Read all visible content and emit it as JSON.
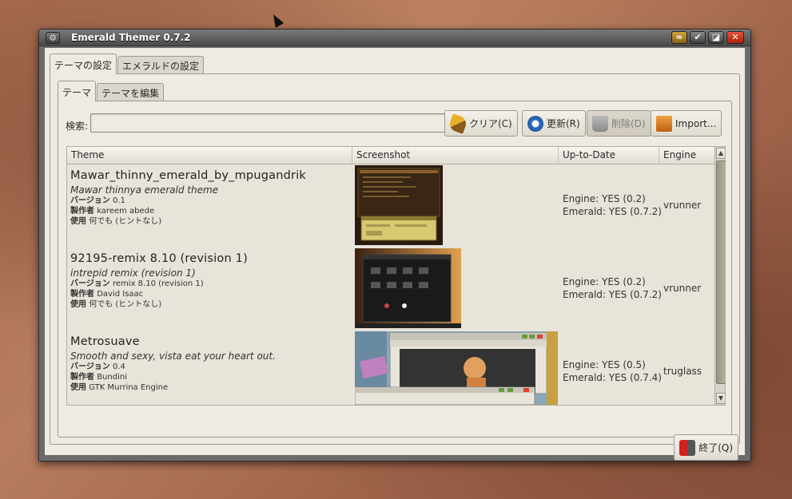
{
  "window": {
    "title": "Emerald Themer 0.7.2",
    "menu_glyph": "⚙",
    "titlebar_buttons": [
      {
        "name": "roll-up-button",
        "glyph": "≈"
      },
      {
        "name": "maximize-button",
        "glyph": "✔"
      },
      {
        "name": "minimize-button",
        "glyph": "◪"
      },
      {
        "name": "close-button",
        "glyph": "✕"
      }
    ]
  },
  "outer_tabs": [
    {
      "label": "テーマの設定",
      "active": true
    },
    {
      "label": "エメラルドの設定",
      "active": false
    }
  ],
  "inner_tabs": [
    {
      "label": "テーマ",
      "active": true
    },
    {
      "label": "テーマを編集",
      "active": false
    }
  ],
  "search": {
    "label": "検索:",
    "value": "",
    "placeholder": ""
  },
  "toolbar": {
    "clear_label": "クリア(C)",
    "update_label": "更新(R)",
    "delete_label": "削除(D)",
    "import_label": "Import..."
  },
  "table": {
    "columns": [
      "Theme",
      "Screenshot",
      "Up-to-Date",
      "Engine"
    ],
    "rows": [
      {
        "name": "Mawar_thinny_emerald_by_mpugandrik",
        "description": "Mawar thinnya emerald theme",
        "version_label": "バージョン",
        "version": "0.1",
        "author_label": "製作者",
        "author": "kareem abede",
        "usage_label": "使用",
        "usage": "何でも (ヒントなし)",
        "engine_status": "Engine: YES (0.2)",
        "emerald_status": "Emerald: YES (0.7.2)",
        "engine": "vrunner"
      },
      {
        "name": "92195-remix 8.10 (revision 1)",
        "description": "intrepid remix (revision 1)",
        "version_label": "バージョン",
        "version": "remix 8.10 (revision 1)",
        "author_label": "製作者",
        "author": "David Isaac",
        "usage_label": "使用",
        "usage": "何でも (ヒントなし)",
        "engine_status": "Engine: YES (0.2)",
        "emerald_status": "Emerald: YES (0.7.2)",
        "engine": "vrunner"
      },
      {
        "name": "Metrosuave",
        "description": "Smooth and sexy, vista eat your heart out.",
        "version_label": "バージョン",
        "version": "0.4",
        "author_label": "製作者",
        "author": "Bundini",
        "usage_label": "使用",
        "usage": "GTK Murrina Engine",
        "engine_status": "Engine: YES (0.5)",
        "emerald_status": "Emerald: YES (0.7.4)",
        "engine": "truglass"
      }
    ]
  },
  "scrollbar": {
    "up_glyph": "▲",
    "down_glyph": "▼"
  },
  "footer": {
    "quit_label": "終了(Q)"
  },
  "colors": {
    "window_bg": "#efebe2",
    "titlebar": "#5a5a5a",
    "close_button": "#d2391f",
    "rollup_button": "#c9962a"
  }
}
